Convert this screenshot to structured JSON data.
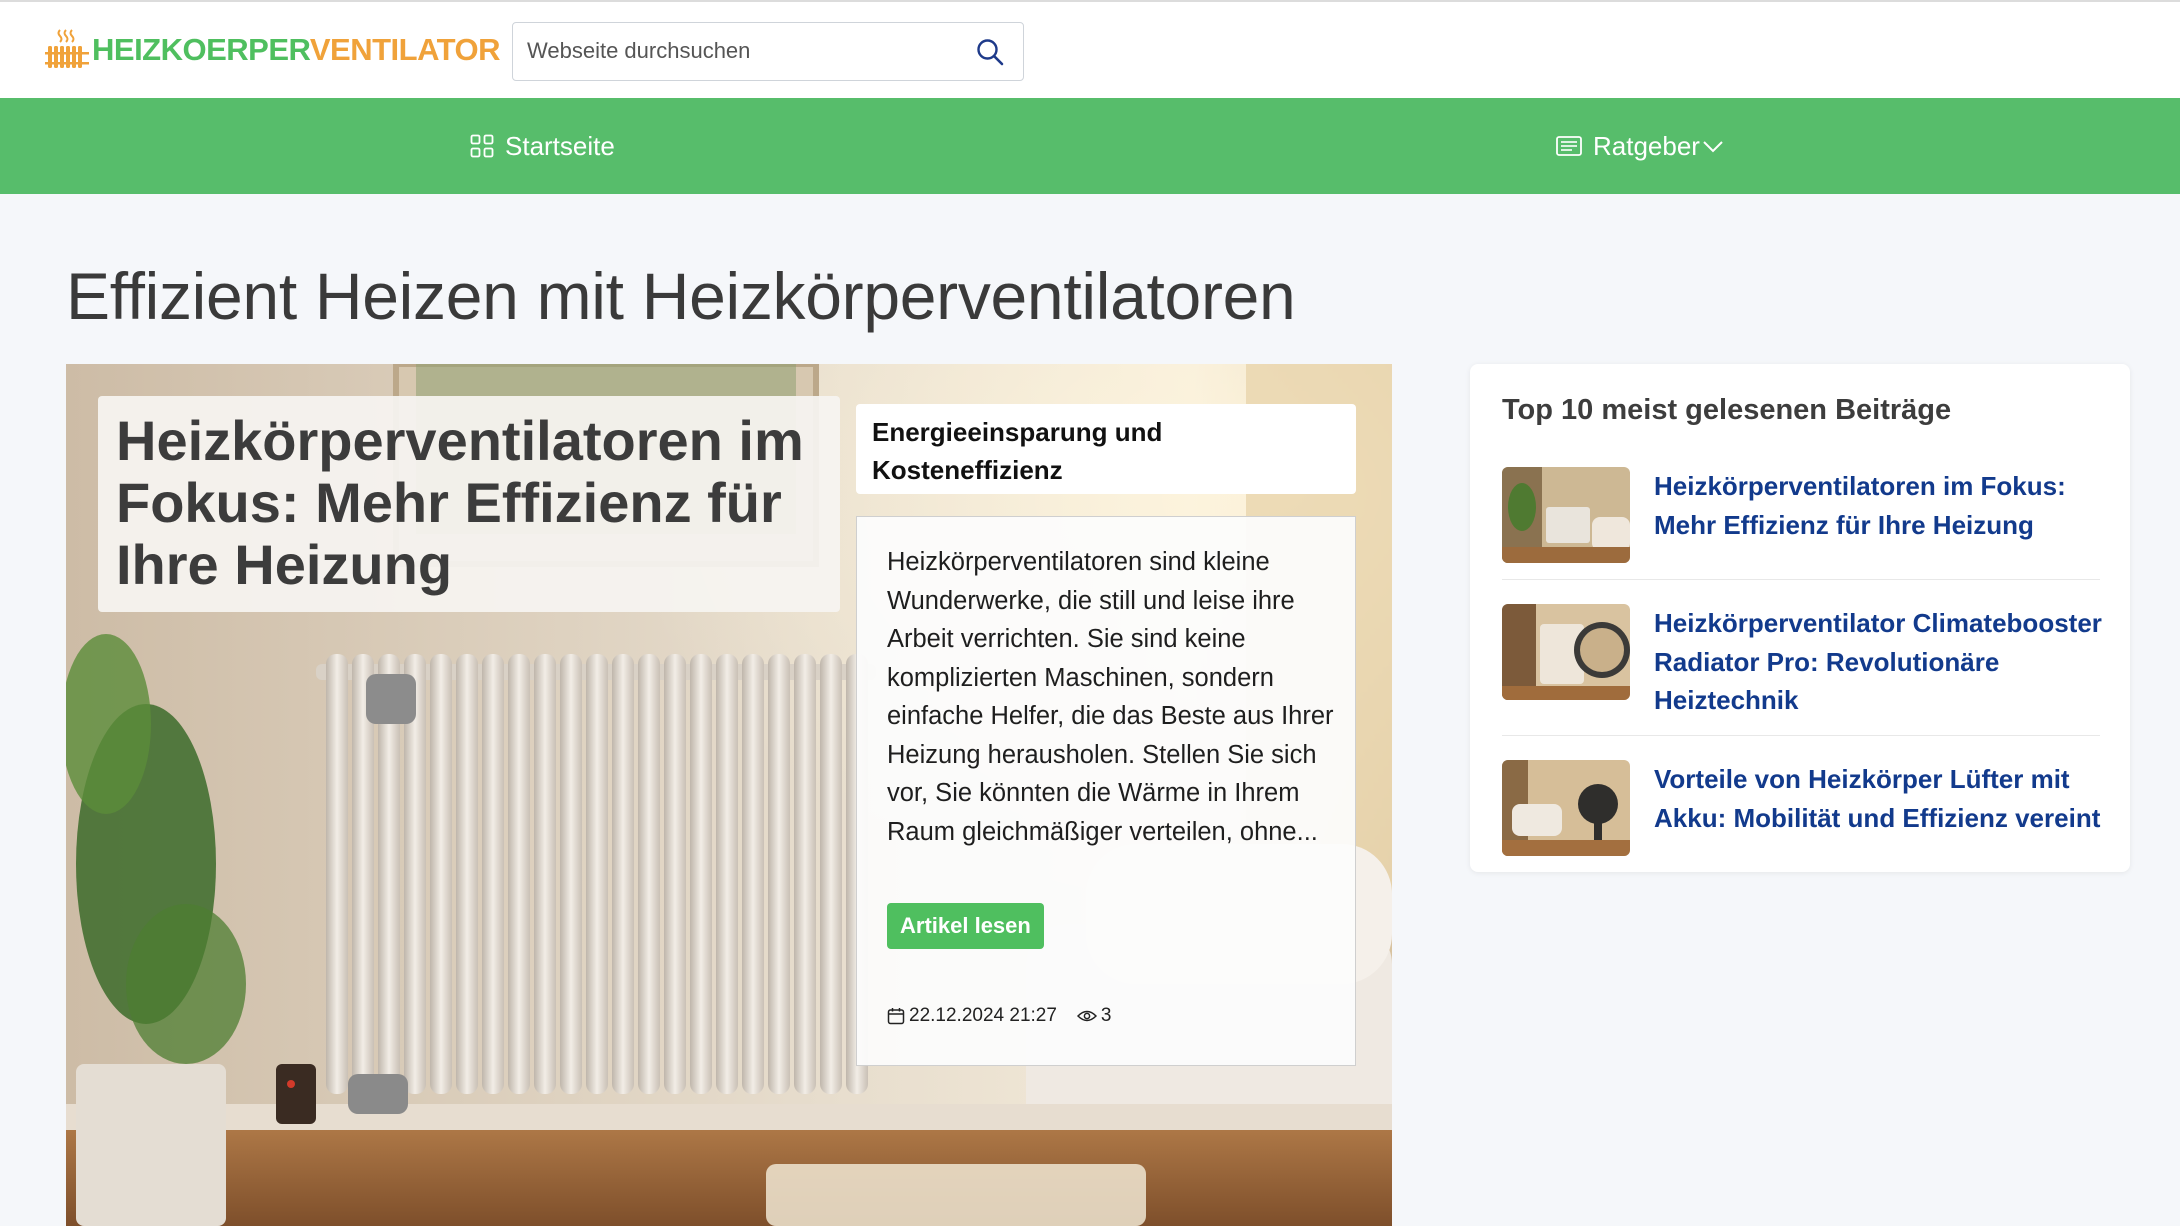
{
  "site": {
    "logo_part1": "HEIZKOERPER",
    "logo_part2": "VENTILATOR",
    "brand_green": "#4fbf5f",
    "brand_orange": "#f0a23a"
  },
  "search": {
    "placeholder": "Webseite durchsuchen",
    "icon": "search-icon"
  },
  "nav": {
    "background": "#57bd6b",
    "items": [
      {
        "label": "Startseite",
        "icon": "grid-icon"
      },
      {
        "label": "Ratgeber",
        "icon": "newspaper-icon",
        "dropdown": true
      }
    ]
  },
  "page": {
    "title": "Effizient Heizen mit Heizkörperventilatoren"
  },
  "featured": {
    "title": "Heizkörperventilatoren im Fokus: Mehr Effizienz für Ihre Heizung",
    "category": "Energieeinsparung und Kosteneffizienz",
    "excerpt": "Heizkörperventilatoren sind kleine Wunderwerke, die still und leise ihre Arbeit verrichten. Sie sind keine komplizierten Maschinen, sondern einfache Helfer, die das Beste aus Ihrer Heizung herausholen. Stellen Sie sich vor, Sie könnten die Wärme in Ihrem Raum gleichmäßiger verteilen, ohne...",
    "button_label": "Artikel lesen",
    "date": "22.12.2024 21:27",
    "views": "3"
  },
  "sidebar": {
    "title": "Top 10 meist gelesenen Beiträge",
    "link_color": "#123a8c",
    "items": [
      {
        "title": "Heizkörperventilatoren im Fokus: Mehr Effizienz für Ihre Heizung"
      },
      {
        "title": "Heizkörperventilator Climatebooster Radiator Pro: Revolutionäre Heiztechnik"
      },
      {
        "title": "Vorteile von Heizkörper Lüfter mit Akku: Mobilität und Effizienz vereint"
      }
    ]
  }
}
